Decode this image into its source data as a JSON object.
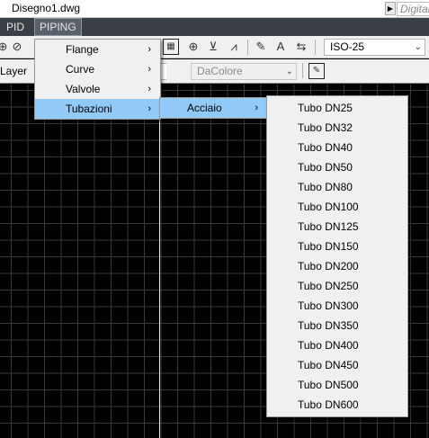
{
  "window": {
    "title": "Disegno1.dwg",
    "search_placeholder": "Digitar"
  },
  "menubar": {
    "items": [
      "PID",
      "PIPING"
    ],
    "active": "PIPING"
  },
  "toolbar": {
    "dimstyle": "ISO-25",
    "layer_label": "Layer",
    "color_combo": "DaColore"
  },
  "menus": {
    "piping": [
      "Flange",
      "Curve",
      "Valvole",
      "Tubazioni"
    ],
    "piping_highlighted": "Tubazioni",
    "tubazioni": [
      "Acciaio"
    ],
    "acciaio": [
      "Tubo DN25",
      "Tubo DN32",
      "Tubo DN40",
      "Tubo DN50",
      "Tubo DN80",
      "Tubo DN100",
      "Tubo DN125",
      "Tubo DN150",
      "Tubo DN200",
      "Tubo DN250",
      "Tubo DN300",
      "Tubo DN350",
      "Tubo DN400",
      "Tubo DN450",
      "Tubo DN500",
      "Tubo DN600"
    ]
  },
  "colors": {
    "menu_highlight": "#91c9f7",
    "menubar_bg": "#3a3f46",
    "canvas_bg": "#000000",
    "grid": "#3a3a3a"
  }
}
